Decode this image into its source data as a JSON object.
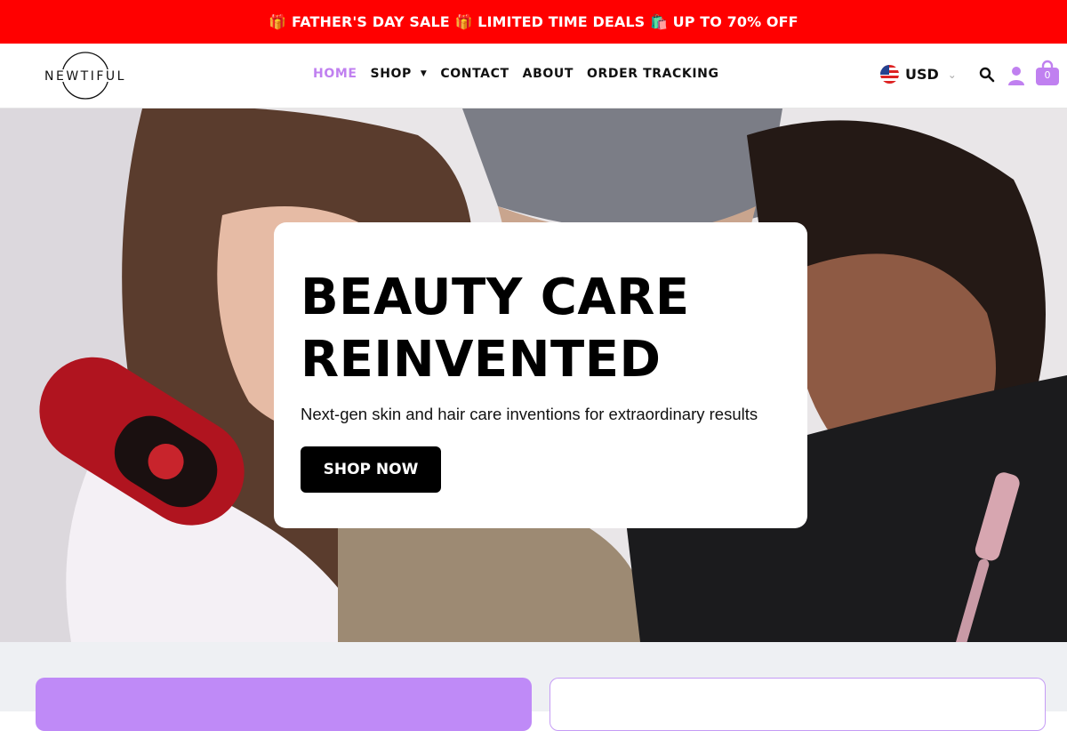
{
  "promo": {
    "text": "🎁 FATHER'S DAY SALE 🎁 LIMITED TIME DEALS 🛍️ UP TO 70% OFF"
  },
  "brand": {
    "logo_text": "NEWTIFUL"
  },
  "nav": {
    "home": "HOME",
    "shop": "SHOP",
    "contact": "CONTACT",
    "about": "ABOUT",
    "order_tracking": "ORDER TRACKING"
  },
  "currency": {
    "code": "USD",
    "flag": "us-flag-icon"
  },
  "cart": {
    "count": "0"
  },
  "hero": {
    "title": "BEAUTY CARE REINVENTED",
    "subtitle": "Next-gen skin and hair care inventions for extraordinary results",
    "cta": "SHOP NOW"
  },
  "colors": {
    "promo_bg": "#ff0000",
    "accent": "#c080f0",
    "tile": "#bf8af7"
  }
}
